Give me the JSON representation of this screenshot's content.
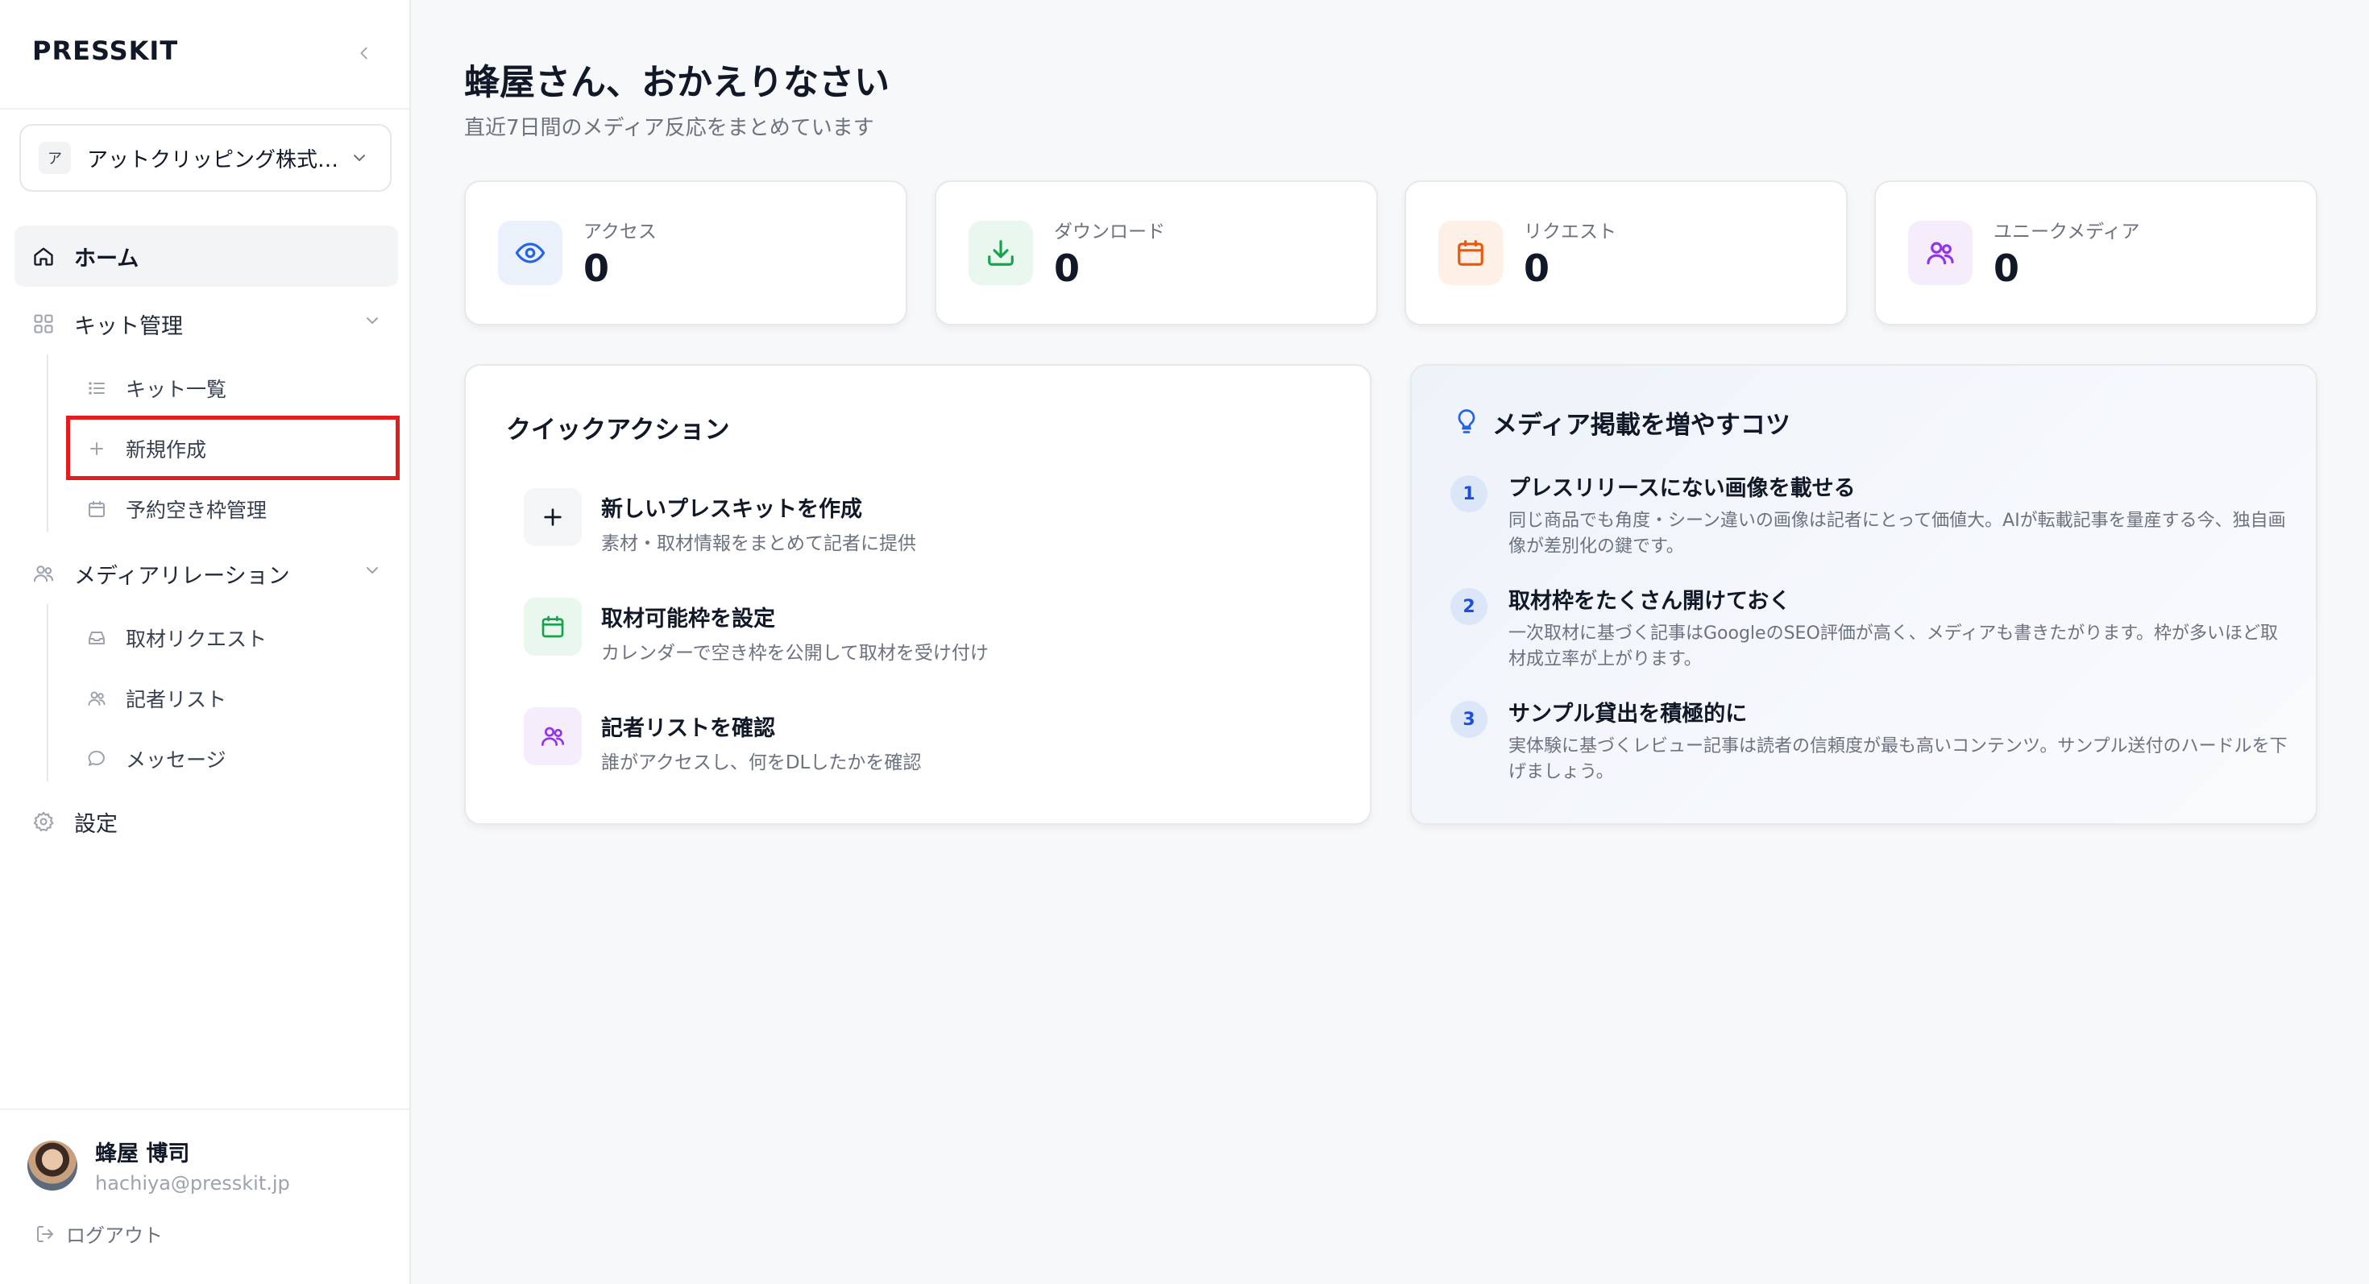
{
  "sidebar": {
    "brand": "PRESSKIT",
    "company": {
      "badge": "ア",
      "name": "アットクリッピング株式…"
    },
    "nav": {
      "home": "ホーム",
      "kit_group": "キット管理",
      "kit_list": "キット一覧",
      "new_create": "新規作成",
      "schedule": "予約空き枠管理",
      "media_group": "メディアリレーション",
      "requests": "取材リクエスト",
      "reporters": "記者リスト",
      "messages": "メッセージ",
      "settings": "設定"
    },
    "user": {
      "name": "蜂屋 博司",
      "email": "hachiya@presskit.jp"
    },
    "logout": "ログアウト"
  },
  "main": {
    "greeting": "蜂屋さん、おかえりなさい",
    "subtitle": "直近7日間のメディア反応をまとめています",
    "stats": [
      {
        "label": "アクセス",
        "value": "0",
        "icon": "eye-icon",
        "color": "#2563eb",
        "bg": "#eaf1fb"
      },
      {
        "label": "ダウンロード",
        "value": "0",
        "icon": "download-icon",
        "color": "#16a34a",
        "bg": "#e9f7ef"
      },
      {
        "label": "リクエスト",
        "value": "0",
        "icon": "calendar-icon",
        "color": "#ea580c",
        "bg": "#fdf1e7"
      },
      {
        "label": "ユニークメディア",
        "value": "0",
        "icon": "users-icon",
        "color": "#9333ea",
        "bg": "#f5edfb"
      }
    ],
    "quick_actions": {
      "title": "クイックアクション",
      "items": [
        {
          "title": "新しいプレスキットを作成",
          "desc": "素材・取材情報をまとめて記者に提供",
          "icon": "plus-icon"
        },
        {
          "title": "取材可能枠を設定",
          "desc": "カレンダーで空き枠を公開して取材を受け付け",
          "icon": "calendar-icon"
        },
        {
          "title": "記者リストを確認",
          "desc": "誰がアクセスし、何をDLしたかを確認",
          "icon": "users-icon"
        }
      ]
    },
    "tips": {
      "title": "メディア掲載を増やすコツ",
      "items": [
        {
          "num": "1",
          "title": "プレスリリースにない画像を載せる",
          "desc": "同じ商品でも角度・シーン違いの画像は記者にとって価値大。AIが転載記事を量産する今、独自画像が差別化の鍵です。"
        },
        {
          "num": "2",
          "title": "取材枠をたくさん開けておく",
          "desc": "一次取材に基づく記事はGoogleのSEO評価が高く、メディアも書きたがります。枠が多いほど取材成立率が上がります。"
        },
        {
          "num": "3",
          "title": "サンプル貸出を積極的に",
          "desc": "実体験に基づくレビュー記事は読者の信頼度が最も高いコンテンツ。サンプル送付のハードルを下げましょう。"
        }
      ]
    }
  }
}
